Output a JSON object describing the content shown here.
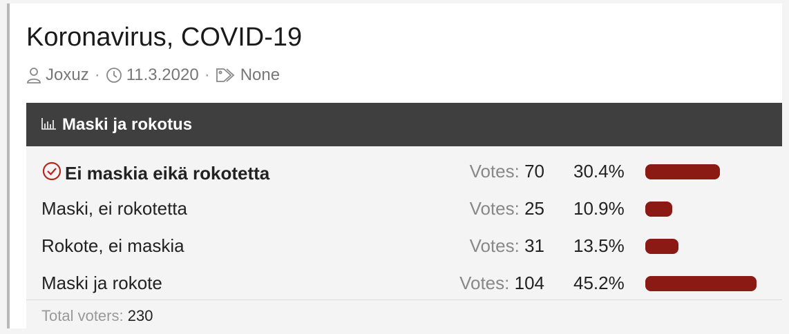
{
  "post": {
    "title": "Koronavirus, COVID-19",
    "author": "Joxuz",
    "date": "11.3.2020",
    "tags": "None",
    "separator": "·"
  },
  "poll": {
    "title": "Maski ja rokotus",
    "bar_color": "#8b1a14",
    "votes_label": "Votes:",
    "options": [
      {
        "label": "Ei maskia eikä rokotetta",
        "votes": "70",
        "percent": "30.4%",
        "fraction": 0.304,
        "selected": true
      },
      {
        "label": "Maski, ei rokotetta",
        "votes": "25",
        "percent": "10.9%",
        "fraction": 0.109,
        "selected": false
      },
      {
        "label": "Rokote, ei maskia",
        "votes": "31",
        "percent": "13.5%",
        "fraction": 0.135,
        "selected": false
      },
      {
        "label": "Maski ja rokote",
        "votes": "104",
        "percent": "45.2%",
        "fraction": 0.452,
        "selected": false
      }
    ],
    "total_label": "Total voters:",
    "total_value": "230"
  }
}
